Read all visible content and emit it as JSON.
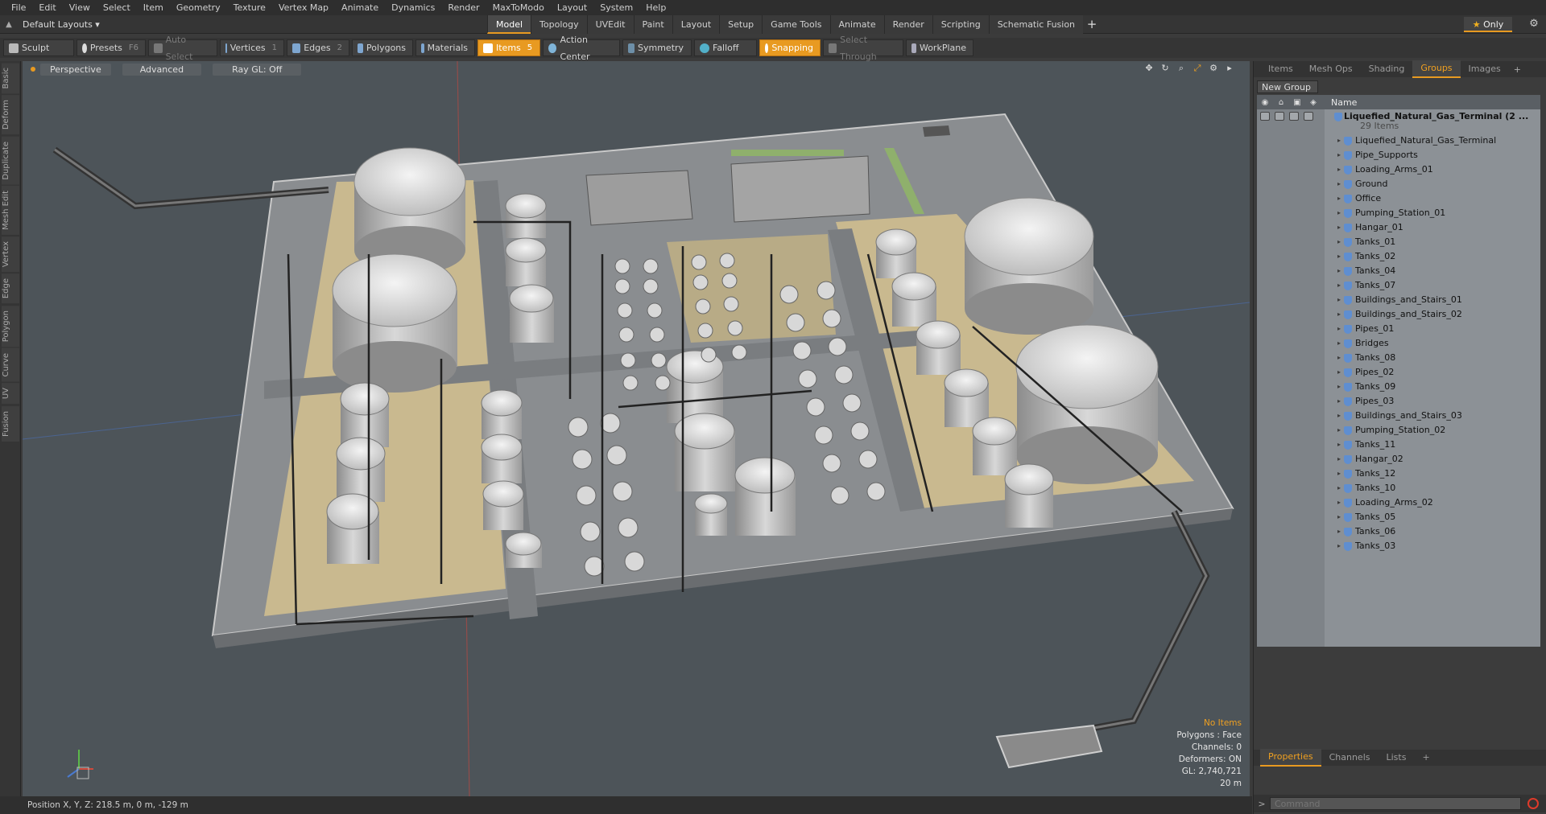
{
  "menu": [
    "File",
    "Edit",
    "View",
    "Select",
    "Item",
    "Geometry",
    "Texture",
    "Vertex Map",
    "Animate",
    "Dynamics",
    "Render",
    "MaxToModo",
    "Layout",
    "System",
    "Help"
  ],
  "layout": {
    "dropdown": "Default Layouts ▾"
  },
  "tabs": [
    {
      "label": "Model",
      "active": true
    },
    {
      "label": "Topology"
    },
    {
      "label": "UVEdit"
    },
    {
      "label": "Paint"
    },
    {
      "label": "Layout"
    },
    {
      "label": "Setup"
    },
    {
      "label": "Game Tools"
    },
    {
      "label": "Animate"
    },
    {
      "label": "Render"
    },
    {
      "label": "Scripting"
    },
    {
      "label": "Schematic Fusion"
    }
  ],
  "tab_add": "+",
  "only_label": "Only",
  "toolbar": {
    "sculpt": "Sculpt",
    "presets": "Presets",
    "presets_key": "F6",
    "auto_select": "Auto Select",
    "vertices": "Vertices",
    "vertices_num": "1",
    "edges": "Edges",
    "edges_num": "2",
    "polygons": "Polygons",
    "materials": "Materials",
    "items": "Items",
    "items_num": "5",
    "action_center": "Action Center",
    "symmetry": "Symmetry",
    "falloff": "Falloff",
    "snapping": "Snapping",
    "select_through": "Select Through",
    "workplane": "WorkPlane"
  },
  "left_tabs": [
    "Basic",
    "Deform",
    "Duplicate",
    "Mesh Edit",
    "Vertex",
    "Edge",
    "Polygon",
    "Curve",
    "UV",
    "Fusion"
  ],
  "viewport": {
    "view": "Perspective",
    "shading": "Advanced",
    "raygl": "Ray GL: Off",
    "info": {
      "selection": "No Items",
      "polygons": "Polygons : Face",
      "channels": "Channels: 0",
      "deformers": "Deformers: ON",
      "gl": "GL: 2,740,721",
      "scale": "20 m"
    }
  },
  "status": {
    "position": "Position X, Y, Z:   218.5 m, 0 m, -129 m"
  },
  "right_panel": {
    "tabs": [
      {
        "label": "Items"
      },
      {
        "label": "Mesh Ops"
      },
      {
        "label": "Shading"
      },
      {
        "label": "Groups",
        "active": true
      },
      {
        "label": "Images"
      }
    ],
    "new_group": "New Group",
    "column_name": "Name",
    "root": {
      "label": "Liquefied_Natural_Gas_Terminal (2 ...",
      "sub": "29 Items"
    },
    "items": [
      "Liquefied_Natural_Gas_Terminal",
      "Pipe_Supports",
      "Loading_Arms_01",
      "Ground",
      "Office",
      "Pumping_Station_01",
      "Hangar_01",
      "Tanks_01",
      "Tanks_02",
      "Tanks_04",
      "Tanks_07",
      "Buildings_and_Stairs_01",
      "Buildings_and_Stairs_02",
      "Pipes_01",
      "Bridges",
      "Tanks_08",
      "Pipes_02",
      "Tanks_09",
      "Pipes_03",
      "Buildings_and_Stairs_03",
      "Pumping_Station_02",
      "Tanks_11",
      "Hangar_02",
      "Tanks_12",
      "Tanks_10",
      "Loading_Arms_02",
      "Tanks_05",
      "Tanks_06",
      "Tanks_03"
    ],
    "bottom_tabs": [
      {
        "label": "Properties",
        "active": true
      },
      {
        "label": "Channels"
      },
      {
        "label": "Lists"
      }
    ],
    "command_placeholder": "Command"
  }
}
